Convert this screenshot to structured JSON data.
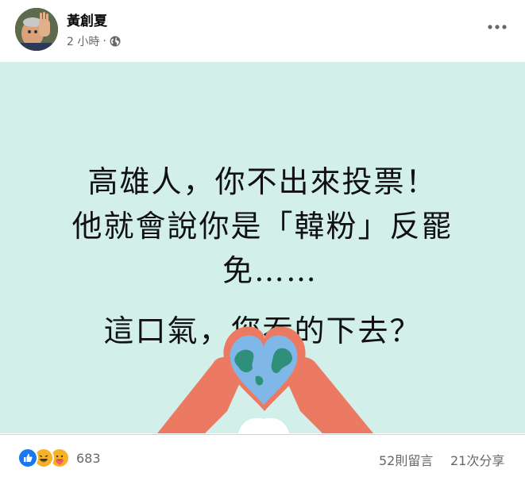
{
  "post": {
    "author_name": "黃創夏",
    "timestamp": "2 小時",
    "separator": "·",
    "privacy_icon": "globe-icon",
    "more_icon": "more-options-icon"
  },
  "image": {
    "lines": [
      "高雄人，你不出來投票！",
      "他就會說你是「韓粉」反罷",
      "免……",
      "這口氣，您吞的下去？"
    ],
    "background_color": "#d2efea"
  },
  "footer": {
    "reaction_icons": [
      "like-icon",
      "haha-icon",
      "care-icon"
    ],
    "reaction_count": "683",
    "comments_label": "52則留言",
    "shares_label": "21次分享"
  }
}
